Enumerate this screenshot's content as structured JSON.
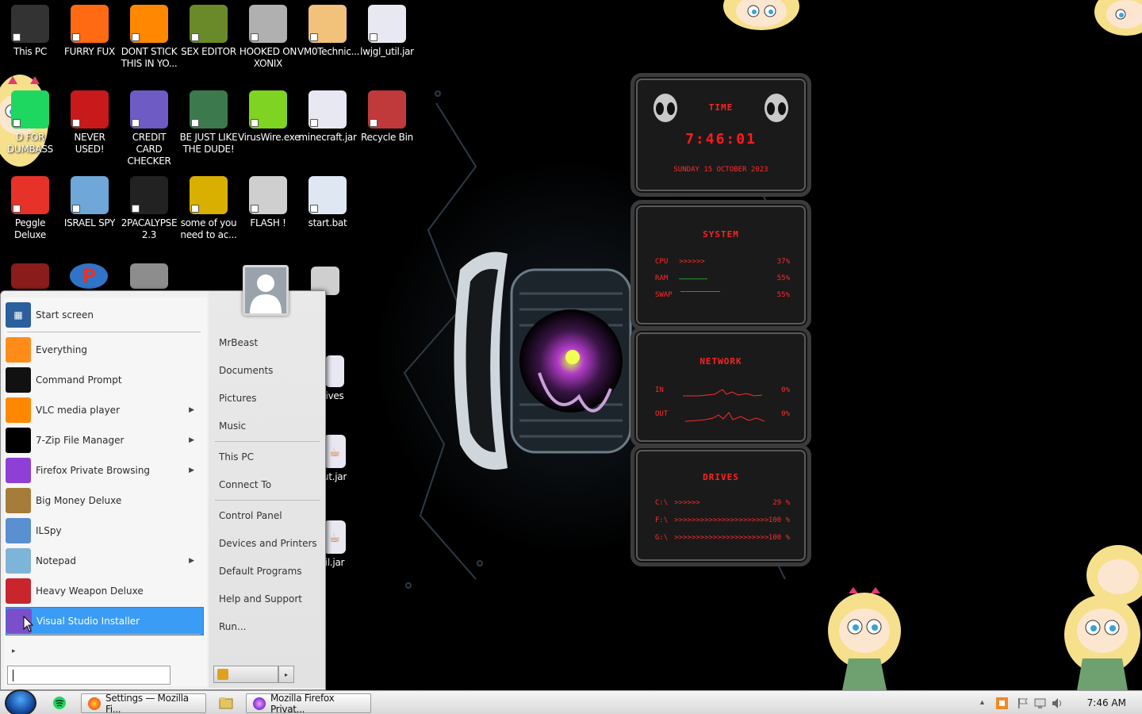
{
  "desktop_icons": [
    {
      "id": "this-pc",
      "label": "This PC",
      "icon": "computer-icon",
      "color": "#333333"
    },
    {
      "id": "furry-fux",
      "label": "FURRY FUX",
      "icon": "firefox-icon",
      "color": "#ff6a13"
    },
    {
      "id": "dont-stick",
      "label": "DONT STICK\nTHIS IN YO...",
      "icon": "vlc-icon",
      "color": "#ff8800"
    },
    {
      "id": "sex-editor",
      "label": "SEX EDITOR",
      "icon": "hxd-icon",
      "color": "#6a8a2a"
    },
    {
      "id": "hooked-xonix",
      "label": "HOOKED ON\nXONIX",
      "icon": "xonix-game-icon",
      "color": "#b0b0b0"
    },
    {
      "id": "vm0",
      "label": "VM0Technic...",
      "icon": "doctor-icon",
      "color": "#f2c27a"
    },
    {
      "id": "lwjgl-util-1",
      "label": "lwjgl_util.jar",
      "icon": "java-icon",
      "color": "#e8e8f2"
    },
    {
      "id": "d-for-dumbass",
      "label": "D FOR\nDUMBASS",
      "icon": "spotify-icon",
      "color": "#1ed760"
    },
    {
      "id": "never-used",
      "label": "NEVER USED!",
      "icon": "devcpp-icon",
      "color": "#c8191b"
    },
    {
      "id": "credit-card",
      "label": "CREDIT CARD\nCHECKER",
      "icon": "credit-card-icon",
      "color": "#6e5bc4"
    },
    {
      "id": "be-just-like",
      "label": "BE JUST LIKE\nTHE DUDE!",
      "icon": "santa-game-icon",
      "color": "#3c7a4e"
    },
    {
      "id": "viruswire",
      "label": "VirusWire.exe",
      "icon": "lime-icon",
      "color": "#7fd321"
    },
    {
      "id": "minecraft-jar",
      "label": "minecraft.jar",
      "icon": "java-icon",
      "color": "#e8e8f2"
    },
    {
      "id": "recycle-bin",
      "label": "Recycle Bin",
      "icon": "recycle-bin-icon",
      "color": "#c0393b"
    },
    {
      "id": "peggle",
      "label": "Peggle Deluxe",
      "icon": "peggle-icon",
      "color": "#e63228"
    },
    {
      "id": "israel-spy",
      "label": "ISRAEL SPY",
      "icon": "network-icon",
      "color": "#6fa7d8"
    },
    {
      "id": "2pacalypse",
      "label": "2PACALYPSE\n2.3",
      "icon": "terminal-icon",
      "color": "#222222"
    },
    {
      "id": "some-of-you",
      "label": "some of you\nneed to ac...",
      "icon": "beaver-icon",
      "color": "#d9b000"
    },
    {
      "id": "flash",
      "label": "FLASH !",
      "icon": "flash-icon",
      "color": "#cfcfcf"
    },
    {
      "id": "start-bat",
      "label": "start.bat",
      "icon": "gear-file-icon",
      "color": "#dfe8f2"
    }
  ],
  "partial_icons": [
    {
      "id": "partial-ives",
      "label": "ives",
      "icon": "file-icon"
    },
    {
      "id": "partial-jar-1",
      "label": "ut.jar",
      "icon": "java-icon"
    },
    {
      "id": "partial-jar-2",
      "label": "il.jar",
      "icon": "java-icon"
    }
  ],
  "start_menu": {
    "pinned": [
      {
        "label": "Start screen",
        "icon": "start-screen-icon",
        "color": "#2b5f9e",
        "arrow": false
      }
    ],
    "programs": [
      {
        "label": "Everything",
        "icon": "magnifier-icon",
        "color": "#ff8c1a",
        "arrow": false
      },
      {
        "label": "Command Prompt",
        "icon": "cmd-icon",
        "color": "#111111",
        "arrow": false
      },
      {
        "label": "VLC media player",
        "icon": "vlc-icon",
        "color": "#ff8800",
        "arrow": true
      },
      {
        "label": "7-Zip File Manager",
        "icon": "7zip-icon",
        "color": "#000000",
        "arrow": true
      },
      {
        "label": "Firefox Private Browsing",
        "icon": "firefox-private-icon",
        "color": "#8e3fd6",
        "arrow": true
      },
      {
        "label": "Big Money Deluxe",
        "icon": "money-bag-icon",
        "color": "#a67c3a",
        "arrow": false
      },
      {
        "label": "ILSpy",
        "icon": "ilspy-icon",
        "color": "#5a8fd0",
        "arrow": false
      },
      {
        "label": "Notepad",
        "icon": "notepad-icon",
        "color": "#7fb4d9",
        "arrow": true
      },
      {
        "label": "Heavy Weapon Deluxe",
        "icon": "radiation-icon",
        "color": "#c9252c",
        "arrow": false
      },
      {
        "label": "Visual Studio Installer",
        "icon": "visual-studio-icon",
        "color": "#7b4fc9",
        "arrow": false,
        "selected": true
      }
    ],
    "all_programs_arrow": "▸",
    "search_placeholder": "",
    "right_pane": {
      "user": "MrBeast",
      "group1": [
        "Documents",
        "Pictures",
        "Music"
      ],
      "group2": [
        "This PC",
        "Connect To"
      ],
      "group3": [
        "Control Panel",
        "Devices and Printers",
        "Default Programs",
        "Help and Support",
        "Run..."
      ]
    },
    "shutdown_arrow": "▸"
  },
  "widgets": {
    "time": {
      "title": "TIME",
      "clock": "7:46:01",
      "date": "SUNDAY 15 OCTOBER 2023"
    },
    "system": {
      "title": "SYSTEM",
      "rows": [
        {
          "label": "CPU",
          "value": "37%",
          "bar": ">>>>>>"
        },
        {
          "label": "RAM",
          "value": "55%",
          "bar": ""
        },
        {
          "label": "SWAP",
          "value": "55%",
          "bar": ""
        }
      ]
    },
    "network": {
      "title": "NETWORK",
      "rows": [
        {
          "label": "IN",
          "value": "0%"
        },
        {
          "label": "OUT",
          "value": "0%"
        }
      ]
    },
    "drives": {
      "title": "DRIVES",
      "rows": [
        {
          "label": "C:\\",
          "value": "29 %",
          "bar": ">>>>>>"
        },
        {
          "label": "F:\\",
          "value": "100 %",
          "bar": ">>>>>>>>>>>>>>>>>>>>>>>>"
        },
        {
          "label": "G:\\",
          "value": "100 %",
          "bar": ">>>>>>>>>>>>>>>>>>>>>>>>"
        }
      ]
    }
  },
  "taskbar": {
    "buttons": [
      {
        "label": "Settings — Mozilla Fi...",
        "icon": "firefox-icon",
        "color": "#ff6a13"
      },
      {
        "label": "Mozilla Firefox Privat...",
        "icon": "firefox-private-icon",
        "color": "#8e3fd6"
      }
    ],
    "clock": "7:46 AM",
    "tray_up_arrow": "▲"
  },
  "colors": {
    "accent_selected": "#3a9cf5",
    "widget_red": "#ff2020",
    "taskbar": "#e4e4e4"
  }
}
